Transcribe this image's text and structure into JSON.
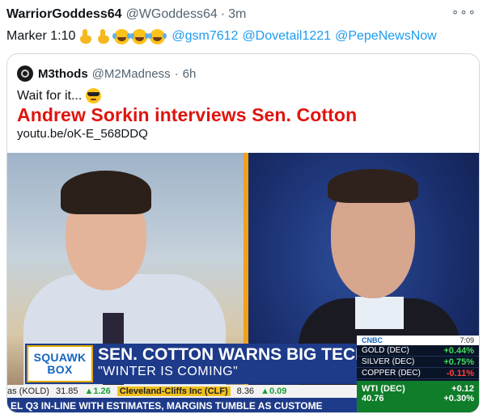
{
  "tweet": {
    "author_name": "WarriorGoddess64",
    "author_handle": "@WGoddess64",
    "separator": "·",
    "time": "3m",
    "more_label": "∘∘∘",
    "text": "Marker 1:10",
    "emojis": [
      "point-down-emoji",
      "point-down-emoji",
      "laugh-cry-emoji",
      "laugh-cry-emoji",
      "laugh-cry-emoji"
    ],
    "mentions": [
      "@gsm7612",
      "@Dovetail1221",
      "@PepeNewsNow"
    ]
  },
  "quote": {
    "author_name": "M3thods",
    "author_handle": "@M2Madness",
    "separator": "·",
    "time": "6h",
    "text": "Wait for it...",
    "headline": "Andrew Sorkin interviews Sen. Cotton",
    "link": "youtu.be/oK-E_568DDQ"
  },
  "video": {
    "logo_line1": "SQUAWK",
    "logo_line2": "BOX",
    "chyron_title": "SEN. COTTON WARNS BIG TECH",
    "chyron_sub": "\"WINTER IS COMING\"",
    "ticker1": {
      "item1_name": "as (KOLD)",
      "item1_value": "31.85",
      "item1_change": "▲1.26",
      "item2_name": "Cleveland-Cliffs Inc (CLF)",
      "item2_value": "8.36",
      "item2_change": "▲0.09"
    },
    "ticker2": "EL Q3 IN-LINE WITH ESTIMATES, MARGINS TUMBLE AS CUSTOME",
    "panel": {
      "brand": "CNBC",
      "clock": "7:09",
      "rows": [
        {
          "label": "GOLD (DEC)",
          "value": "+0.44%"
        },
        {
          "label": "SILVER (DEC)",
          "value": "+0.75%"
        },
        {
          "label": "COPPER (DEC)",
          "value": "-0.11%"
        }
      ],
      "wti_label": "WTI (DEC)",
      "wti_change": "+0.12",
      "wti_price": "40.76",
      "wti_pct": "+0.30%"
    }
  },
  "colors": {
    "link": "#1d9bf0",
    "headline": "#e0140e",
    "chyron": "#1e3b8a",
    "up": "#3ddc5a",
    "down": "#ff4040"
  }
}
